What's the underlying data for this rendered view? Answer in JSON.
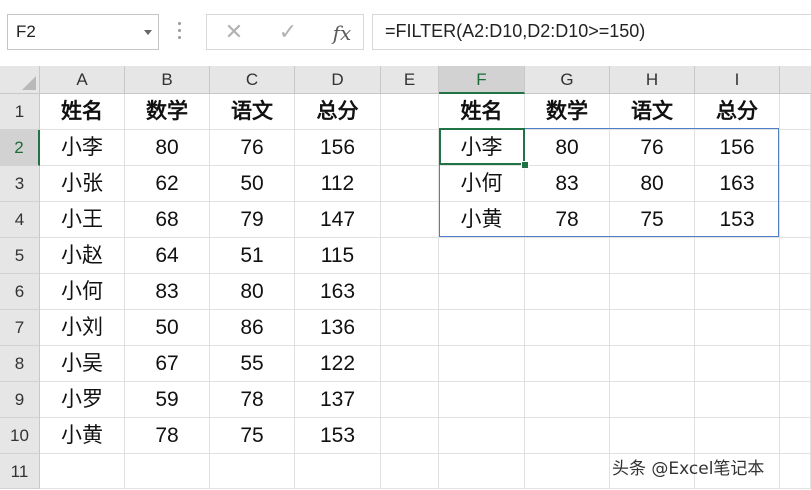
{
  "namebox": {
    "value": "F2"
  },
  "formula_bar": {
    "cancel_icon": "✕",
    "enter_icon": "✓",
    "fx_label": "fx",
    "formula": "=FILTER(A2:D10,D2:D10>=150)"
  },
  "selected_cell": "F2",
  "columns": [
    "A",
    "B",
    "C",
    "D",
    "E",
    "F",
    "G",
    "H",
    "I"
  ],
  "rows": [
    "1",
    "2",
    "3",
    "4",
    "5",
    "6",
    "7",
    "8",
    "9",
    "10",
    "11"
  ],
  "source_table": {
    "headers": [
      "姓名",
      "数学",
      "语文",
      "总分"
    ],
    "rows": [
      [
        "小李",
        "80",
        "76",
        "156"
      ],
      [
        "小张",
        "62",
        "50",
        "112"
      ],
      [
        "小王",
        "68",
        "79",
        "147"
      ],
      [
        "小赵",
        "64",
        "51",
        "115"
      ],
      [
        "小何",
        "83",
        "80",
        "163"
      ],
      [
        "小刘",
        "50",
        "86",
        "136"
      ],
      [
        "小吴",
        "67",
        "55",
        "122"
      ],
      [
        "小罗",
        "59",
        "78",
        "137"
      ],
      [
        "小黄",
        "78",
        "75",
        "153"
      ]
    ]
  },
  "result_table": {
    "headers": [
      "姓名",
      "数学",
      "语文",
      "总分"
    ],
    "rows": [
      [
        "小李",
        "80",
        "76",
        "156"
      ],
      [
        "小何",
        "83",
        "80",
        "163"
      ],
      [
        "小黄",
        "78",
        "75",
        "153"
      ]
    ]
  },
  "watermark": "头条 @Excel笔记本",
  "colors": {
    "selection": "#217346",
    "spill_border": "#4f7fc8",
    "header_bg": "#e6e6e6"
  }
}
